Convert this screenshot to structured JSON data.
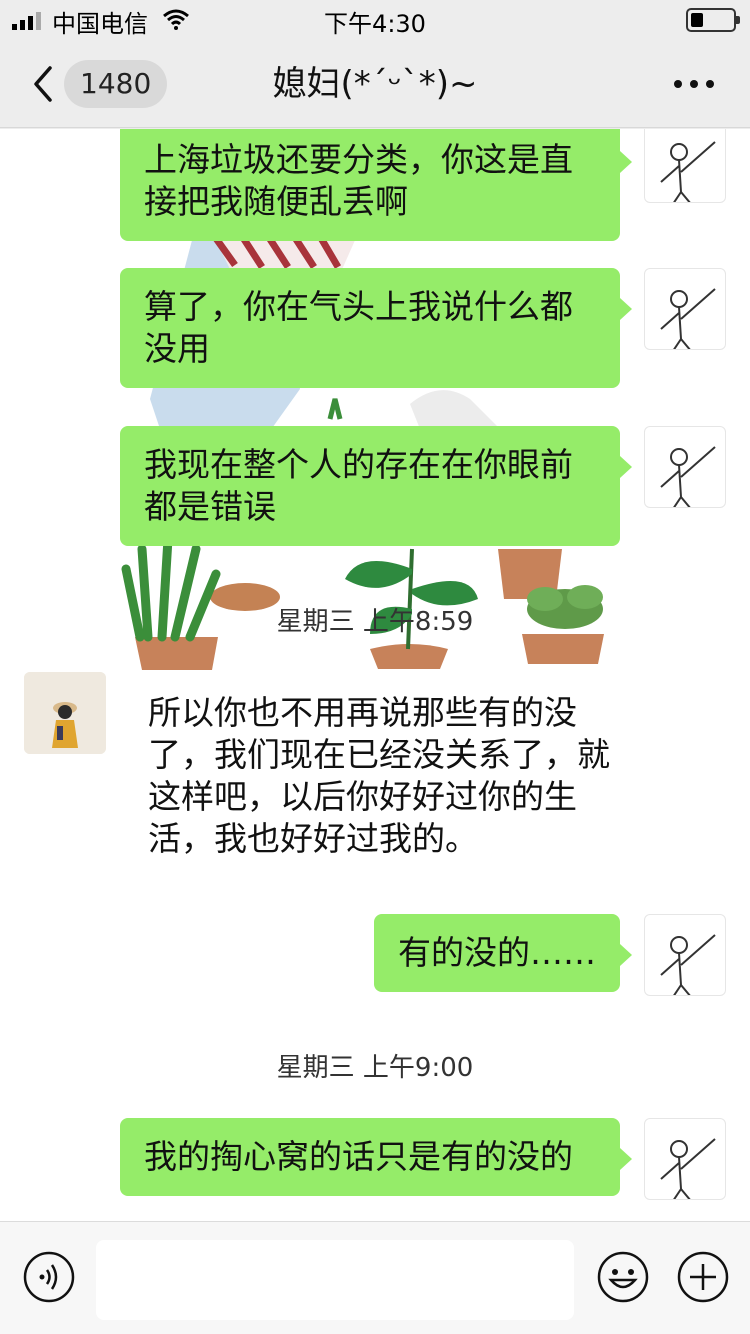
{
  "status_bar": {
    "carrier": "中国电信",
    "time": "下午4:30"
  },
  "nav": {
    "back_icon": "chevron-left-icon",
    "unread_count": "1480",
    "title": "媳妇(*ˊᵕˋ*)~",
    "more_icon": "ellipsis-icon"
  },
  "messages": [
    {
      "direction": "out",
      "text": "上海垃圾还要分类，你这是直接把我随便乱丢啊"
    },
    {
      "direction": "out",
      "text": "算了，你在气头上我说什么都没用"
    },
    {
      "direction": "out",
      "text": "我现在整个人的存在在你眼前都是错误"
    },
    {
      "timestamp": "星期三 上午8:59"
    },
    {
      "direction": "in",
      "text": "所以你也不用再说那些有的没了，我们现在已经没关系了，就这样吧，以后你好好过你的生活，我也好好过我的。"
    },
    {
      "direction": "out",
      "text": "有的没的……"
    },
    {
      "timestamp": "星期三 上午9:00"
    },
    {
      "direction": "out",
      "text": "我的掏心窝的话只是有的没的"
    }
  ],
  "input_bar": {
    "voice_icon": "voice-icon",
    "input_value": "",
    "emoji_icon": "emoji-icon",
    "plus_icon": "plus-icon"
  },
  "colors": {
    "outgoing_bubble": "#95ec69",
    "nav_background": "#ededed",
    "chat_background": "#ffffff"
  }
}
